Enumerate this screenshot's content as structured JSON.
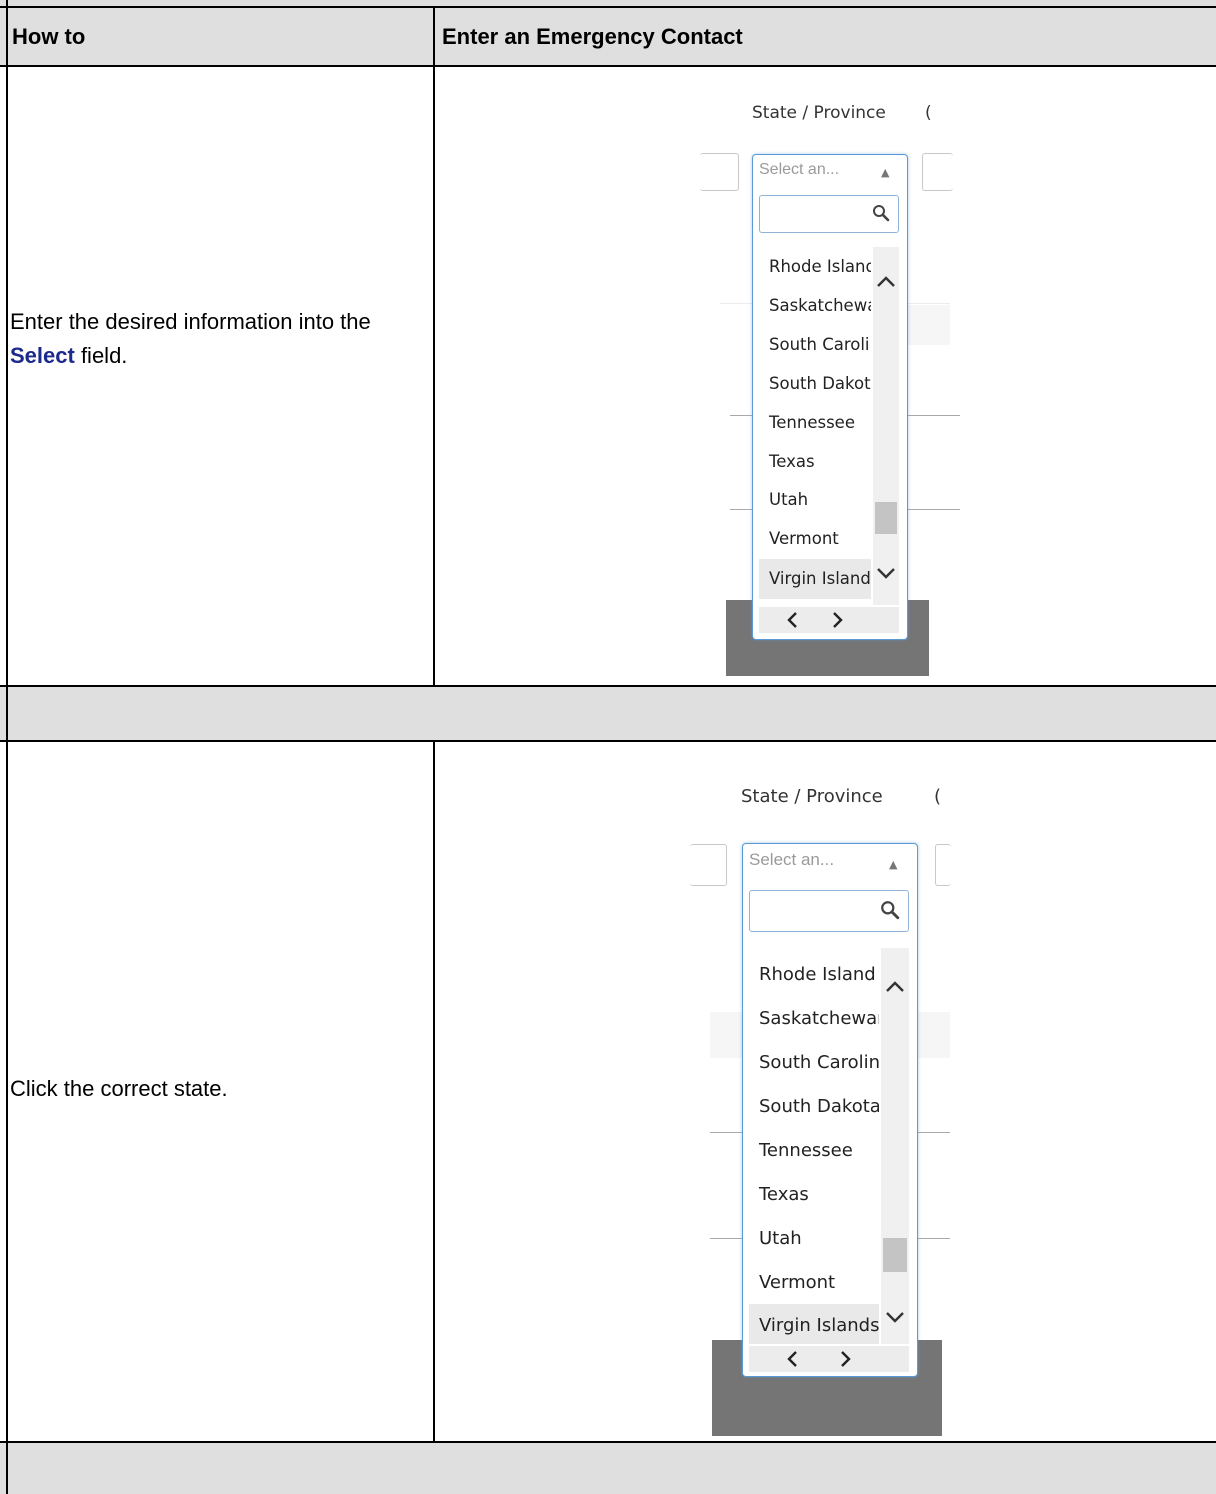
{
  "table": {
    "header": {
      "col1": "How to",
      "col2": "Enter an Emergency Contact"
    },
    "rows": [
      {
        "instruction_prefix": "Enter the desired information into the ",
        "instruction_keyword": "Select",
        "instruction_suffix": " field.",
        "screenshot": {
          "field_label": "State / Province",
          "trailing_label": "(",
          "select_placeholder": "Select an...",
          "search_icon": "search-icon",
          "options": [
            "Rhode Island",
            "Saskatchewan",
            "South Carolina",
            "South Dakota",
            "Tennessee",
            "Texas",
            "Utah",
            "Vermont",
            "Virgin Islands"
          ],
          "highlighted_option": "Virgin Islands"
        }
      },
      {
        "instruction": "Click the correct state.",
        "screenshot": {
          "field_label": "State / Province",
          "trailing_label": "(",
          "select_placeholder": "Select an...",
          "search_icon": "search-icon",
          "options": [
            "Rhode Island",
            "Saskatchewan",
            "South Carolina",
            "South Dakota",
            "Tennessee",
            "Texas",
            "Utah",
            "Vermont",
            "Virgin Islands"
          ],
          "highlighted_option": "Virgin Islands"
        }
      }
    ]
  },
  "colors": {
    "header_bg": "#dfdfdf",
    "keyword": "#1c2a8c",
    "focus_border": "#5b9bd5"
  }
}
